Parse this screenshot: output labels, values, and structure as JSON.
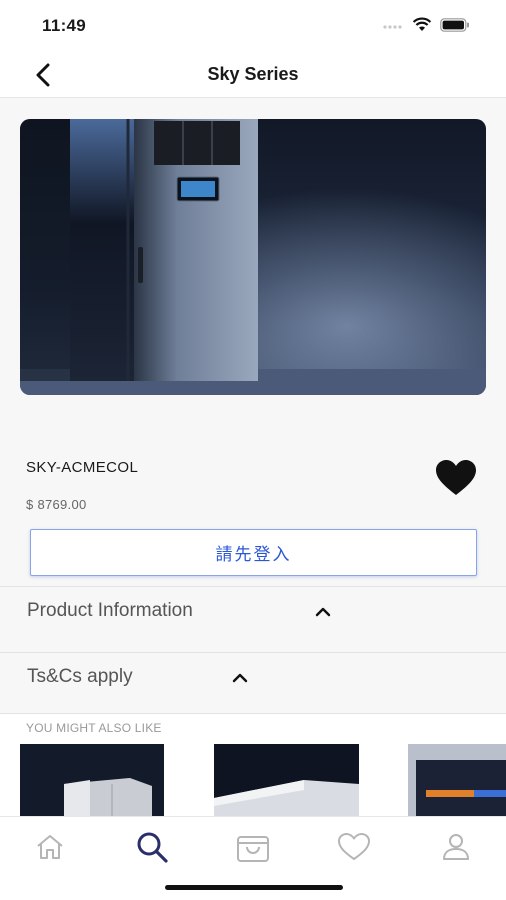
{
  "status_bar": {
    "time": "11:49"
  },
  "nav": {
    "title": "Sky Series"
  },
  "product": {
    "name": "SKY-ACMECOL",
    "price": "$ 8769.00",
    "favorited": true
  },
  "login_button": {
    "label": "請先登入"
  },
  "sections": {
    "product_info": "Product Information",
    "terms": "Ts&Cs apply"
  },
  "recommendations": {
    "title": "YOU MIGHT ALSO LIKE"
  },
  "tab_bar": {
    "active": "search",
    "tabs": [
      "home-icon",
      "search-icon",
      "bag-icon",
      "heart-icon",
      "profile-icon"
    ]
  },
  "colors": {
    "accent": "#2b57d6",
    "active_tab": "#2a2f6b",
    "inactive_tab": "#b5b5b5"
  }
}
